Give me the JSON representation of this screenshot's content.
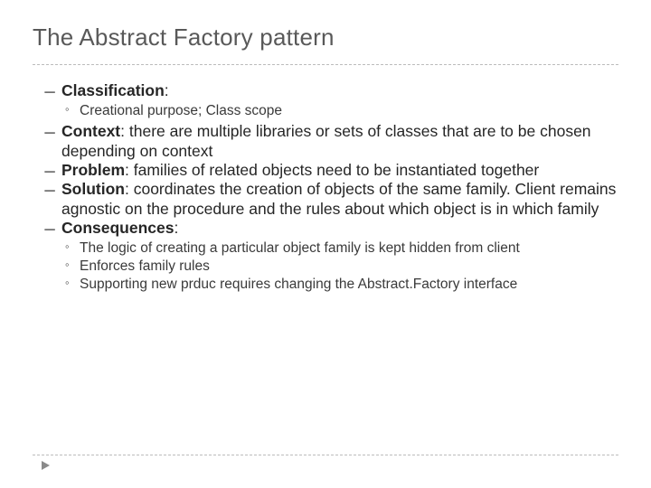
{
  "title": "The Abstract Factory pattern",
  "bullet_glyph": "─",
  "sub_glyph": "◦",
  "items": {
    "classification": {
      "label": "Classification",
      "sub": [
        "Creational purpose; Class scope"
      ]
    },
    "context": {
      "label": "Context",
      "body": ": there are multiple libraries or sets of classes that are to be chosen depending on context"
    },
    "problem": {
      "label": "Problem",
      "body": ": families of related objects need to be instantiated together"
    },
    "solution": {
      "label": "Solution",
      "body": ": coordinates the creation of objects of the same family. Client remains agnostic on the procedure and the rules about which object is in which family"
    },
    "consequences": {
      "label": "Consequences",
      "body": ":",
      "sub": [
        "The logic of creating a particular object family is kept hidden from client",
        "Enforces family rules",
        "Supporting new prduc requires changing the Abstract.Factory interface"
      ]
    }
  }
}
